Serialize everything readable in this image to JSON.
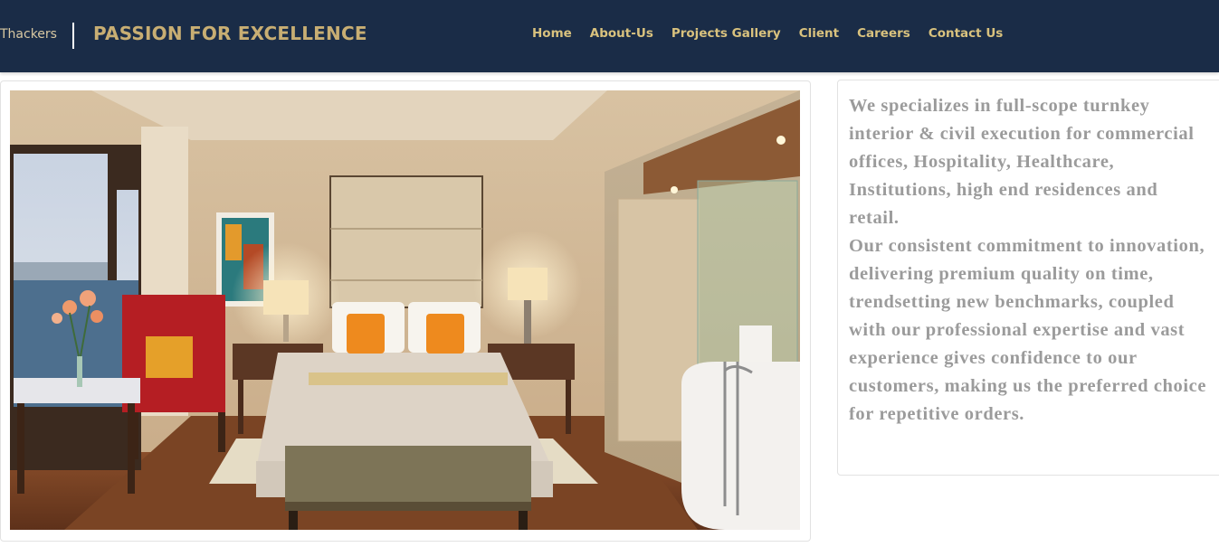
{
  "header": {
    "brand_small": "Thackers",
    "brand_title": "PASSION FOR EXCELLENCE",
    "nav": [
      "Home",
      "About-Us",
      "Projects Gallery",
      "Client",
      "Careers",
      "Contact Us"
    ],
    "colors": {
      "background": "#1a2c47",
      "nav_text": "#d9c27e",
      "title_text": "#c8ae73"
    }
  },
  "hero": {
    "image_subject": "hotel-bedroom-with-sea-view-and-bathroom"
  },
  "intro": {
    "paragraphs": [
      "We specializes in full-scope turnkey interior & civil execution for commercial offices, Hospitality, Healthcare, Institutions, high end residences and retail.",
      "Our consistent commitment to innovation, delivering premium quality on time, trendsetting new benchmarks, coupled with our professional expertise and vast experience gives confidence to our customers, making us the preferred choice for repetitive orders."
    ],
    "color": "#9b9b9b"
  }
}
